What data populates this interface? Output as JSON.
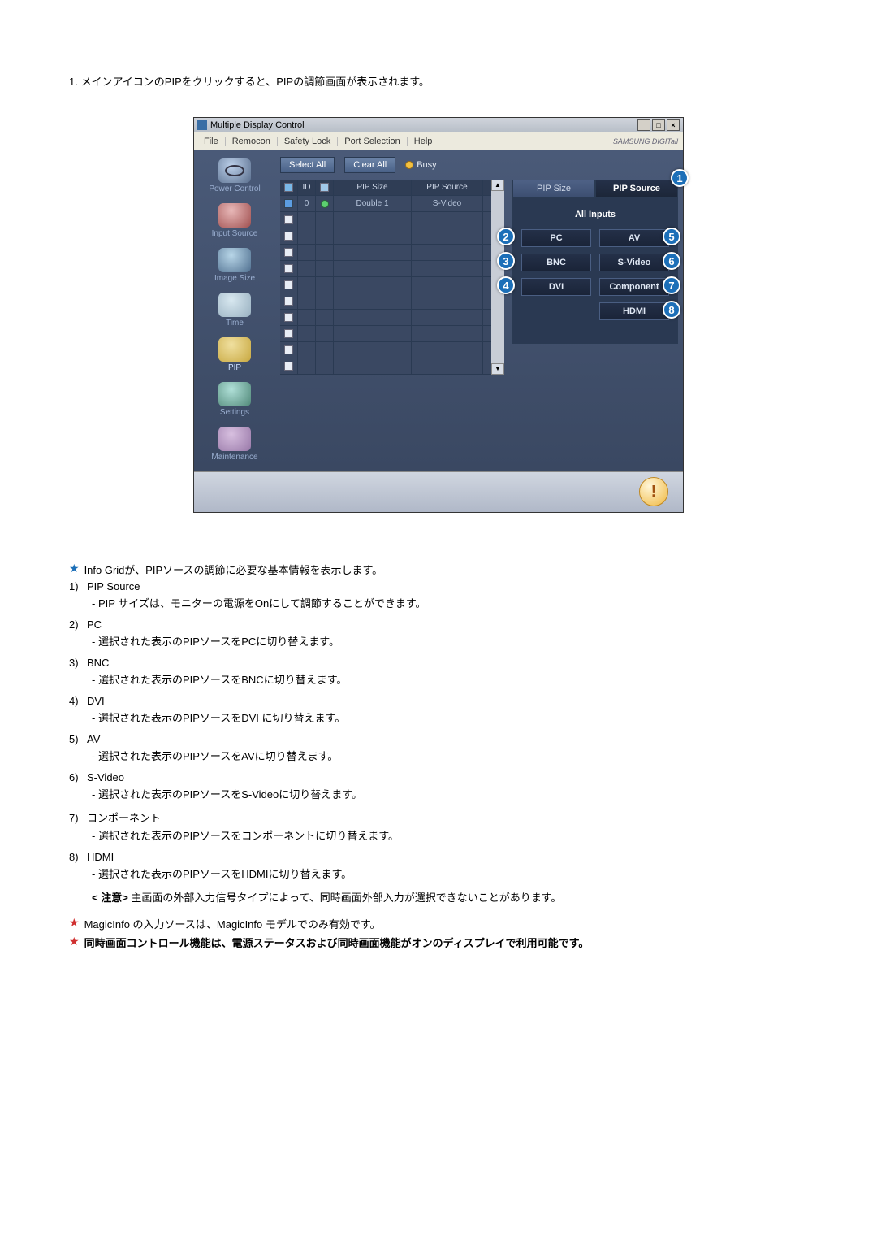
{
  "intro": "1.  メインアイコンのPIPをクリックすると、PIPの調節画面が表示されます。",
  "window": {
    "title": "Multiple Display Control",
    "title_btn_min": "_",
    "title_btn_max": "□",
    "title_btn_close": "×",
    "menu": {
      "file": "File",
      "remocon": "Remocon",
      "safety": "Safety Lock",
      "port": "Port Selection",
      "help": "Help"
    },
    "brand": "SAMSUNG DIGITall",
    "sidebar": {
      "power": "Power Control",
      "input": "Input Source",
      "size": "Image Size",
      "time": "Time",
      "pip": "PIP",
      "settings": "Settings",
      "maint": "Maintenance"
    },
    "toolbar": {
      "select_all": "Select All",
      "clear_all": "Clear All",
      "busy": "Busy"
    },
    "grid": {
      "col_id": "ID",
      "col_size": "PIP Size",
      "col_source": "PIP Source",
      "row_id": "0",
      "row_size": "Double 1",
      "row_source": "S-Video"
    },
    "tabs": {
      "pip_size": "PIP Size",
      "pip_source": "PIP Source"
    },
    "panel": {
      "all_inputs": "All Inputs",
      "pc": "PC",
      "av": "AV",
      "bnc": "BNC",
      "svideo": "S-Video",
      "dvi": "DVI",
      "component": "Component",
      "hdmi": "HDMI"
    },
    "callouts": {
      "c1": "1",
      "c2": "2",
      "c3": "3",
      "c4": "4",
      "c5": "5",
      "c6": "6",
      "c7": "7",
      "c8": "8"
    },
    "warn_glyph": "!"
  },
  "notes": {
    "info_grid": "Info Gridが、PIPソースの調節に必要な基本情報を表示します。",
    "items": [
      {
        "num": "1)",
        "title": "PIP Source",
        "desc": "- PIP サイズは、モニターの電源をOnにして調節することができます。"
      },
      {
        "num": "2)",
        "title": "PC",
        "desc": "- 選択された表示のPIPソースをPCに切り替えます。"
      },
      {
        "num": "3)",
        "title": "BNC",
        "desc": "- 選択された表示のPIPソースをBNCに切り替えます。"
      },
      {
        "num": "4)",
        "title": "DVI",
        "desc": "- 選択された表示のPIPソースをDVI に切り替えます。"
      },
      {
        "num": "5)",
        "title": "AV",
        "desc": "- 選択された表示のPIPソースをAVに切り替えます。"
      },
      {
        "num": "6)",
        "title": "S-Video",
        "desc": "- 選択された表示のPIPソースをS-Videoに切り替えます。"
      },
      {
        "num": "7)",
        "title": "コンポーネント",
        "desc": "- 選択された表示のPIPソースをコンポーネントに切り替えます。"
      },
      {
        "num": "8)",
        "title": "HDMI",
        "desc": "- 選択された表示のPIPソースをHDMIに切り替えます。"
      }
    ],
    "caution_label": "< 注意>",
    "caution_text": "  主画面の外部入力信号タイプによって、同時画面外部入力が選択できないことがあります。",
    "magicinfo": "MagicInfo の入力ソースは、MagicInfo モデルでのみ有効です。",
    "pip_power": "同時画面コントロール機能は、電源ステータスおよび同時画面機能がオンのディスプレイで利用可能です。"
  }
}
